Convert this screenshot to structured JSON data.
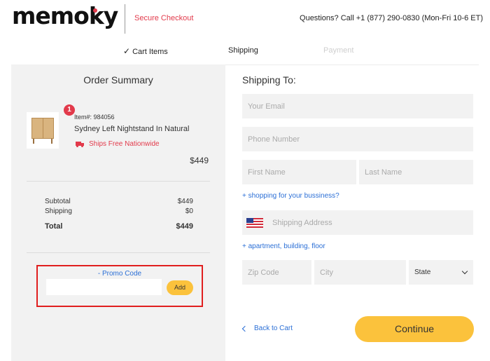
{
  "header": {
    "logo": "memoky",
    "secure_checkout": "Secure Checkout",
    "questions": "Questions? Call +1 (877) 290-0830 (Mon-Fri 10-6 ET)"
  },
  "steps": {
    "cart": "Cart Items",
    "shipping": "Shipping",
    "payment": "Payment",
    "completed_icon": "checkmark-icon"
  },
  "summary": {
    "title": "Order Summary",
    "item": {
      "quantity": "1",
      "item_number": "Item#: 984056",
      "name": "Sydney Left Nightstand In Natural",
      "shipping_note": "Ships Free Nationwide",
      "price": "$449"
    },
    "subtotal_label": "Subtotal",
    "subtotal_value": "$449",
    "shipping_label": "Shipping",
    "shipping_value": "$0",
    "total_label": "Total",
    "total_value": "$449",
    "promo_label": "-  Promo Code",
    "promo_value": "",
    "promo_add": "Add"
  },
  "shipping": {
    "title": "Shipping To:",
    "email_placeholder": "Your Email",
    "phone_placeholder": "Phone Number",
    "first_name_placeholder": "First Name",
    "last_name_placeholder": "Last Name",
    "business_link": "+ shopping for your bussiness?",
    "address_placeholder": "Shipping Address",
    "apartment_link": "+ apartment, building, floor",
    "zip_placeholder": "Zip Code",
    "city_placeholder": "City",
    "state_selected": "State"
  },
  "actions": {
    "back": "Back to Cart",
    "continue": "Continue"
  },
  "colors": {
    "accent": "#e23a4b",
    "link": "#2b6fd6",
    "button": "#fbc23c",
    "panel": "#f2f2f2"
  }
}
